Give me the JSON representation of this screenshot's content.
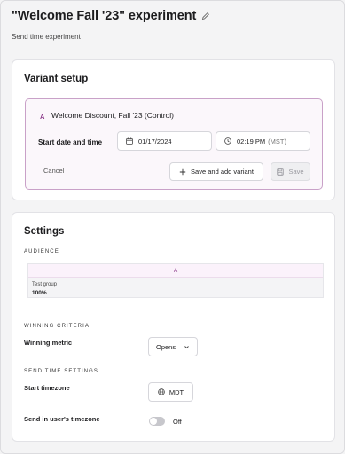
{
  "header": {
    "title": "\"Welcome Fall '23\" experiment",
    "subtitle": "Send time experiment",
    "edit_icon": "pencil-icon"
  },
  "variant_setup": {
    "title": "Variant setup",
    "variant": {
      "letter": "A",
      "name": "Welcome Discount, Fall '23 (Control)"
    },
    "start_label": "Start date and time",
    "date_value": "01/17/2024",
    "time_value": "02:19 PM",
    "time_zone": "(MST)",
    "cancel_label": "Cancel",
    "add_variant_label": "Save and add variant",
    "save_label": "Save",
    "icons": {
      "date": "calendar-icon",
      "time": "clock-icon",
      "add": "plus-icon",
      "save": "floppy-disk-icon"
    },
    "accent_color": "#8b3a8a"
  },
  "settings": {
    "title": "Settings",
    "audience_label": "AUDIENCE",
    "audience": {
      "variant_letter": "A",
      "group_label": "Test group",
      "percent": "100%",
      "fraction": 1.0
    },
    "winning_criteria_label": "WINNING CRITERIA",
    "winning_metric_label": "Winning metric",
    "winning_metric_value": "Opens",
    "send_time_settings_label": "SEND TIME SETTINGS",
    "start_timezone_label": "Start timezone",
    "start_timezone_value": "MDT",
    "users_timezone_label": "Send in user's timezone",
    "users_timezone_state": "Off",
    "icons": {
      "chevron": "chevron-down-icon",
      "globe": "globe-icon"
    }
  }
}
